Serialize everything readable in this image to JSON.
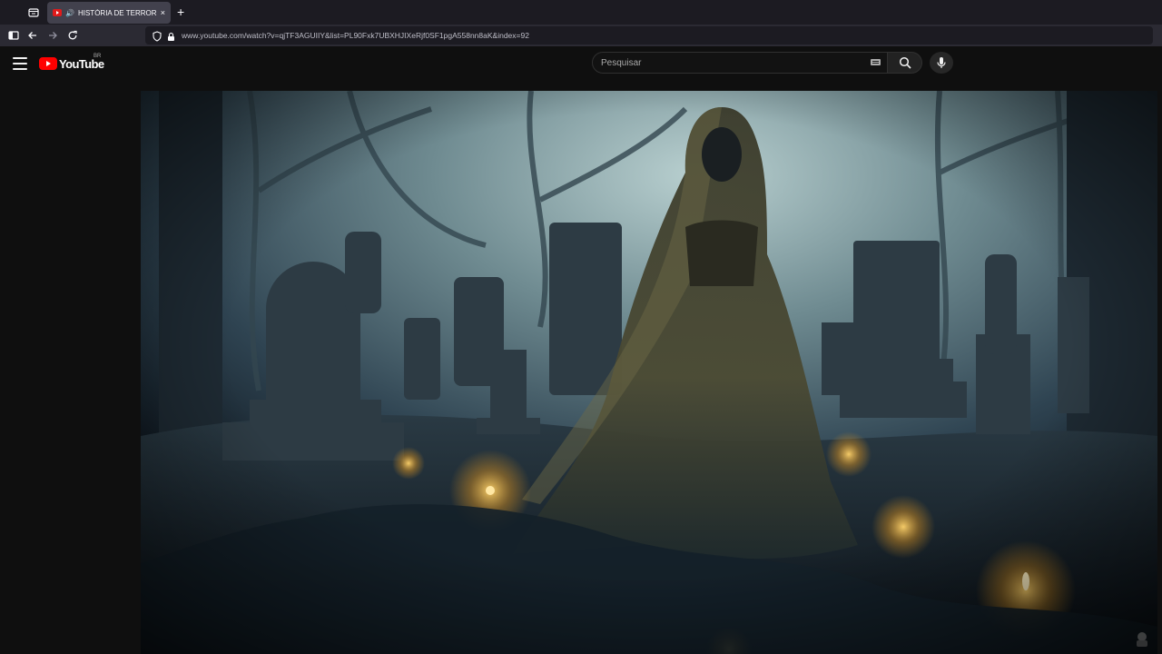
{
  "browser": {
    "tab": {
      "title": "HISTÓRIA DE TERROR : POR",
      "audio_icon": "speaker-icon",
      "close_label": "×"
    },
    "new_tab_label": "+",
    "url": "www.youtube.com/watch?v=qjTF3AGUIIY&list=PL90Fxk7UBXHJIXeRjf0SF1pgA558nn8aK&index=92"
  },
  "youtube": {
    "country_code": "BR",
    "logo_text": "YouTube",
    "search": {
      "placeholder": "Pesquisar",
      "value": ""
    }
  },
  "player": {
    "thumbnail_description_icon": "video-frame"
  },
  "colors": {
    "youtube_red": "#ff0000",
    "page_bg": "#0f0f0f",
    "browser_tabstrip": "#1c1b22",
    "browser_navbar": "#2b2a33"
  }
}
